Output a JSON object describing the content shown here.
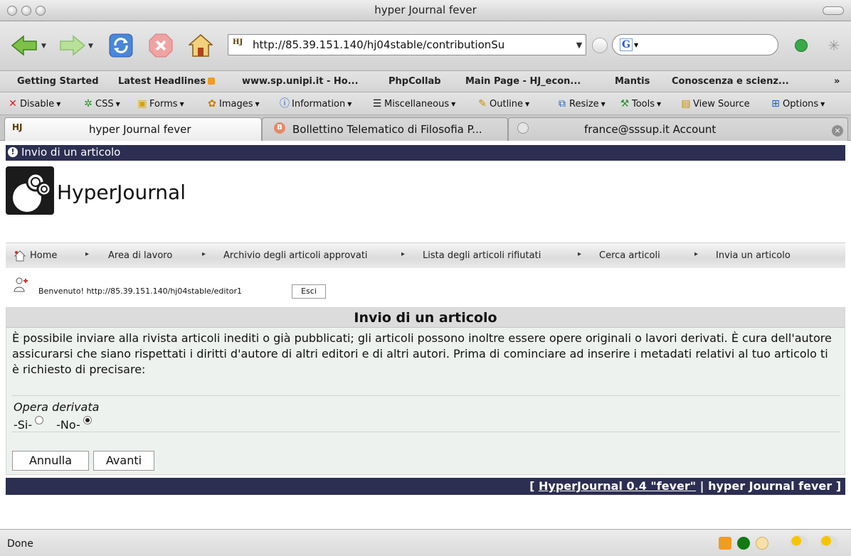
{
  "window": {
    "title": "hyper Journal fever"
  },
  "address_bar": {
    "url": "http://85.39.151.140/hj04stable/contributionSu"
  },
  "bookmarks": [
    "Getting Started",
    "Latest Headlines",
    "www.sp.unipi.it - Ho...",
    "PhpCollab",
    "Main Page - HJ_econ...",
    "Mantis",
    "Conoscenza e scienz...",
    "»"
  ],
  "devtools": [
    "Disable",
    "CSS",
    "Forms",
    "Images",
    "Information",
    "Miscellaneous",
    "Outline",
    "Resize",
    "Tools",
    "View Source",
    "Options"
  ],
  "tabs": [
    {
      "label": "hyper Journal fever",
      "active": true
    },
    {
      "label": "Bollettino Telematico di Filosofia P...",
      "active": false
    },
    {
      "label": "france@sssup.it Account",
      "active": false
    }
  ],
  "page": {
    "strip_title": "Invio di un articolo",
    "logo_text": "HyperJournal",
    "menu": [
      "Home",
      "Area di lavoro",
      "Archivio degli articoli approvati",
      "Lista degli articoli rifiutati",
      "Cerca articoli",
      "Invia un articolo"
    ],
    "welcome": "Benvenuto! http://85.39.151.140/hj04stable/editor1",
    "logout_label": "Esci",
    "panel_title": "Invio di un articolo",
    "panel_text": "È possibile inviare alla rivista articoli inediti o già pubblicati; gli articoli possono inoltre essere opere originali o lavori derivati. È cura dell'autore assicurarsi che siano rispettati i diritti d'autore di altri editori e di altri autori. Prima di cominciare ad inserire i metadati relativi al tuo articolo ti è richiesto di precisare:",
    "fieldset_legend": "Opera derivata",
    "radio_yes": "-Si-",
    "radio_no": "-No-",
    "selected_option": "No",
    "cancel_label": "Annulla",
    "next_label": "Avanti",
    "footer_open": "[ ",
    "footer_link": "HyperJournal 0.4 \"fever\"",
    "footer_rest": " | hyper Journal fever ]"
  },
  "status": {
    "text": "Done"
  },
  "colors": {
    "strip": "#2c2f52",
    "panel_bg": "#eef2ee",
    "panel_head": "#dcdcdc"
  }
}
